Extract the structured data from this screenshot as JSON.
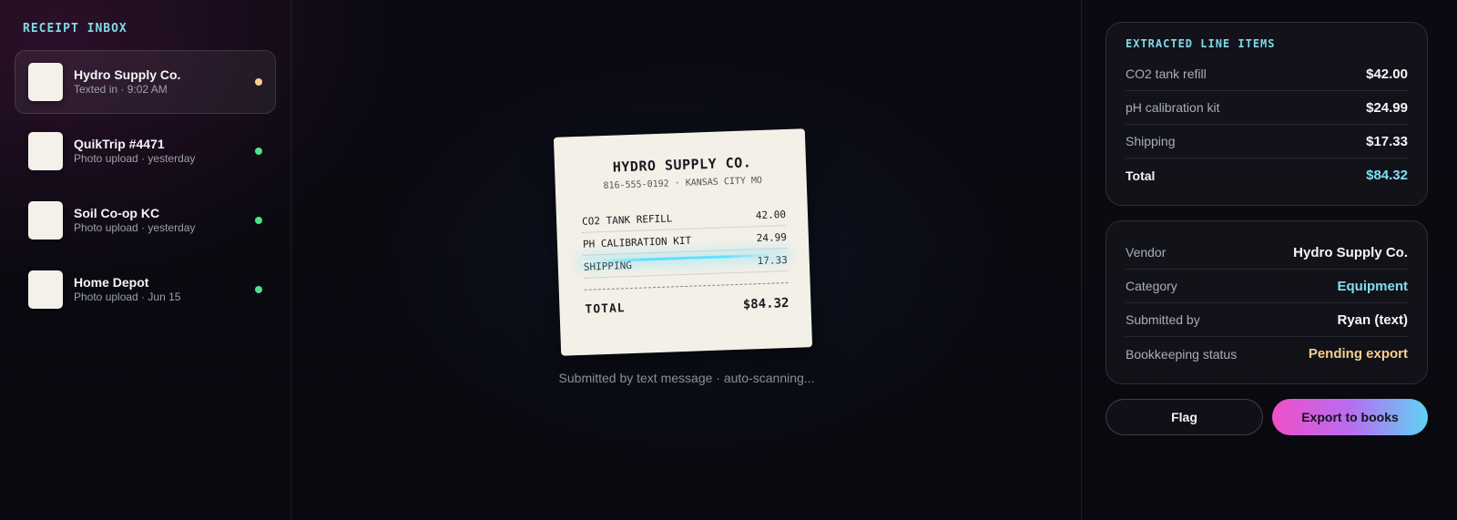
{
  "sidebar": {
    "title": "RECEIPT INBOX",
    "items": [
      {
        "name": "Hydro Supply Co.",
        "sub": "Texted in · 9:02 AM",
        "status_color": "#f7cf8e",
        "active": true
      },
      {
        "name": "QuikTrip #4471",
        "sub": "Photo upload · yesterday",
        "status_color": "#4ee28a",
        "active": false
      },
      {
        "name": "Soil Co-op KC",
        "sub": "Photo upload · yesterday",
        "status_color": "#4ee28a",
        "active": false
      },
      {
        "name": "Home Depot",
        "sub": "Photo upload · Jun 15",
        "status_color": "#4ee28a",
        "active": false
      }
    ]
  },
  "receipt": {
    "vendor": "HYDRO SUPPLY CO.",
    "meta": "816-555-0192 · KANSAS CITY MO",
    "lines": [
      {
        "item": "CO2 TANK REFILL",
        "amount": "42.00"
      },
      {
        "item": "PH CALIBRATION KIT",
        "amount": "24.99"
      },
      {
        "item": "SHIPPING",
        "amount": "17.33"
      }
    ],
    "total_label": "TOTAL",
    "total_value": "$84.32"
  },
  "center": {
    "caption": "Submitted by text message · auto-scanning..."
  },
  "line_items": {
    "title": "EXTRACTED LINE ITEMS",
    "rows": [
      {
        "label": "CO2 tank refill",
        "value": "$42.00"
      },
      {
        "label": "pH calibration kit",
        "value": "$24.99"
      },
      {
        "label": "Shipping",
        "value": "$17.33"
      }
    ],
    "total_label": "Total",
    "total_value": "$84.32"
  },
  "meta": {
    "vendor_label": "Vendor",
    "vendor_value": "Hydro Supply Co.",
    "category_label": "Category",
    "category_value": "Equipment",
    "submitted_label": "Submitted by",
    "submitted_value": "Ryan (text)",
    "status_label": "Bookkeeping status",
    "status_value": "Pending export"
  },
  "actions": {
    "flag_label": "Flag",
    "export_label": "Export to books"
  },
  "colors": {
    "accent_cyan": "#7fdbe6",
    "total_cyan": "#7fe0f0",
    "category_cyan": "#7fe0f0",
    "pending_amber": "#f7cf8e",
    "ready_green": "#4ee28a"
  }
}
